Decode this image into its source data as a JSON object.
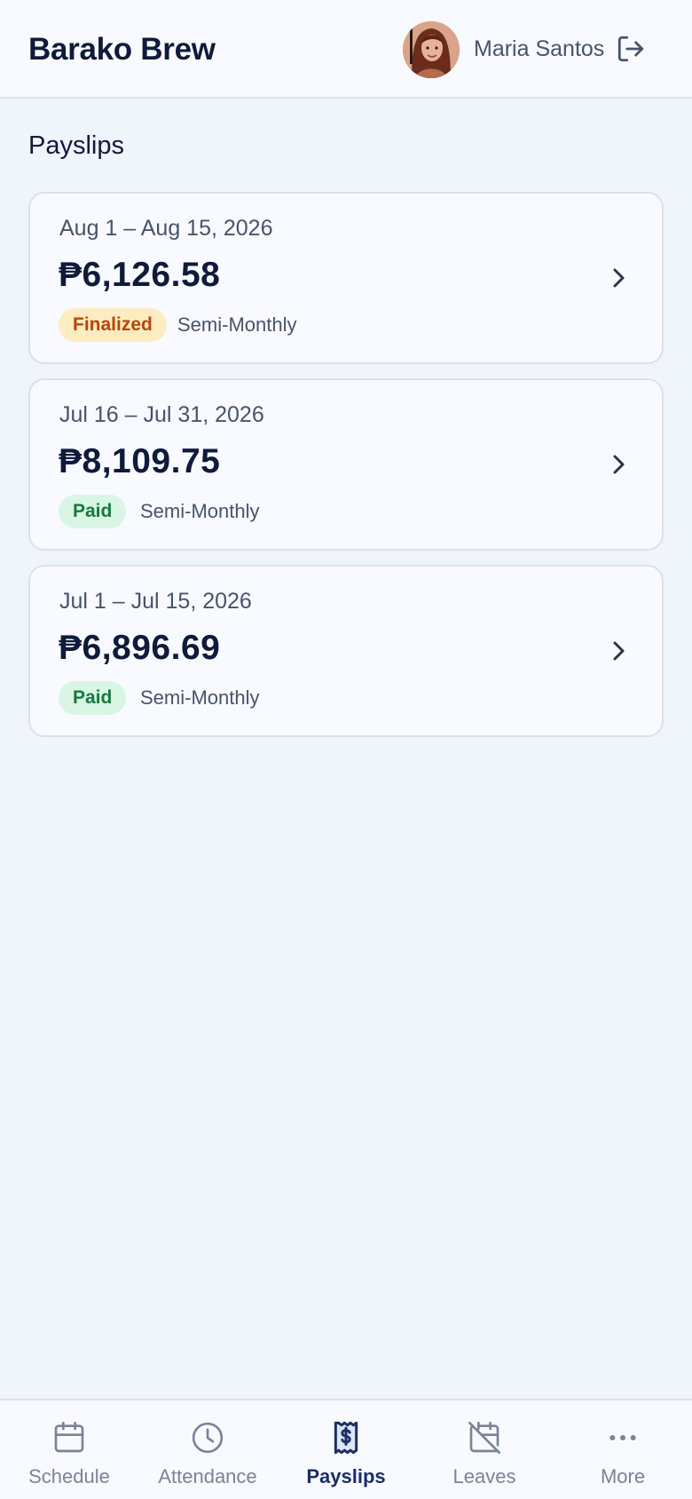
{
  "header": {
    "brand": "Barako Brew",
    "user_name": "Maria Santos",
    "avatar_icon": "user-avatar-photo",
    "logout_icon": "logout-icon"
  },
  "main": {
    "title": "Payslips",
    "payslips": [
      {
        "period": "Aug 1 – Aug 15, 2026",
        "amount": "₱6,126.58",
        "status": "Finalized",
        "frequency": "Semi-Monthly"
      },
      {
        "period": "Jul 16 – Jul 31, 2026",
        "amount": "₱8,109.75",
        "status": "Paid",
        "frequency": "Semi-Monthly"
      },
      {
        "period": "Jul 1 – Jul 15, 2026",
        "amount": "₱6,896.69",
        "status": "Paid",
        "frequency": "Semi-Monthly"
      }
    ]
  },
  "nav": {
    "items": [
      {
        "label": "Schedule",
        "icon": "calendar-icon",
        "active": false
      },
      {
        "label": "Attendance",
        "icon": "clock-icon",
        "active": false
      },
      {
        "label": "Payslips",
        "icon": "receipt-dollar-icon",
        "active": true
      },
      {
        "label": "Leaves",
        "icon": "calendar-off-icon",
        "active": false
      },
      {
        "label": "More",
        "icon": "more-dots-icon",
        "active": false
      }
    ]
  },
  "colors": {
    "background": "#f0f4fb",
    "surface": "#f8faff",
    "text_primary": "#0f1b3a",
    "finalized_bg": "#fdecc0",
    "finalized_text": "#b54708",
    "paid_bg": "#d9f5e3",
    "paid_text": "#167a3f",
    "nav_active": "#1a2f66"
  }
}
